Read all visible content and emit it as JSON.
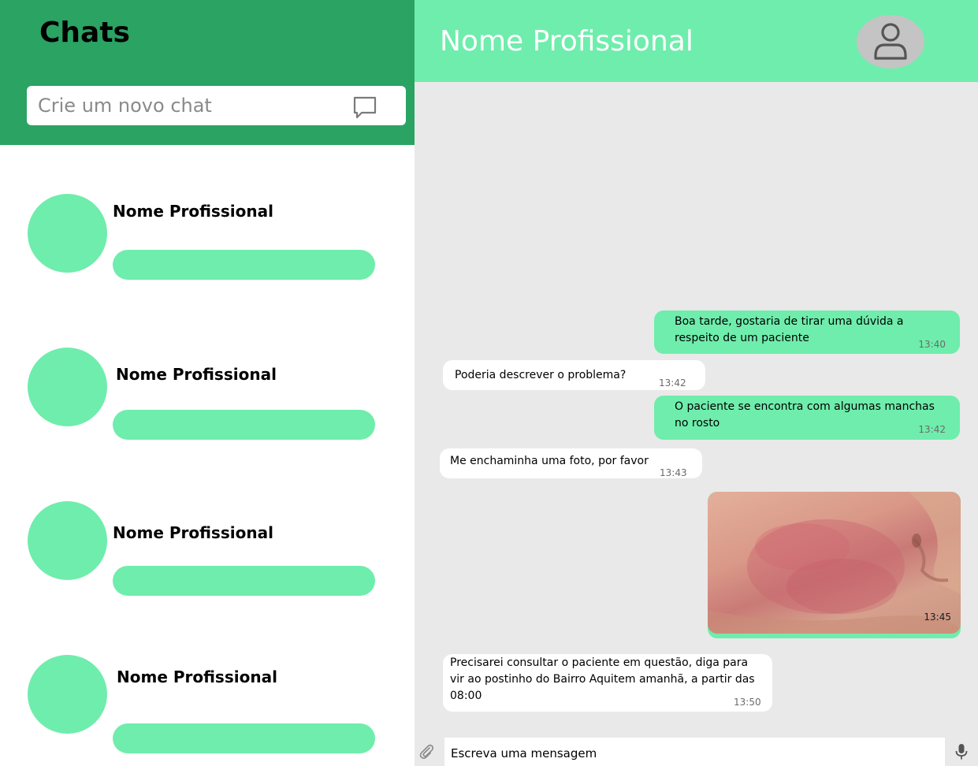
{
  "sidebar": {
    "title": "Chats",
    "search_placeholder": "Crie um novo chat",
    "chats": [
      {
        "name": "Nome Profissional"
      },
      {
        "name": "Nome Profissional"
      },
      {
        "name": "Nome Profissional"
      },
      {
        "name": "Nome Profissional"
      }
    ]
  },
  "conversation": {
    "contact_name": "Nome Profissional",
    "messages": [
      {
        "direction": "outgoing",
        "text": "Boa tarde, gostaria de tirar uma dúvida a respeito de um paciente",
        "time": "13:40"
      },
      {
        "direction": "incoming",
        "text": "Poderia descrever o problema?",
        "time": "13:42"
      },
      {
        "direction": "outgoing",
        "text": "O paciente se encontra com algumas manchas no rosto",
        "time": "13:42"
      },
      {
        "direction": "incoming",
        "text": "Me enchaminha uma foto, por favor",
        "time": "13:43"
      },
      {
        "direction": "outgoing",
        "type": "image",
        "time": "13:45"
      },
      {
        "direction": "incoming",
        "text": "Precisarei consultar o paciente em questão, diga para vir ao postinho do Bairro Aquitem amanhã, a partir das 08:00",
        "time": "13:50"
      }
    ],
    "composer_placeholder": "Escreva uma mensagem"
  },
  "icons": {
    "new_chat": "chat-bubble-icon",
    "profile": "user-icon",
    "attach": "paperclip-icon",
    "mic": "microphone-icon"
  },
  "colors": {
    "sidebar_header": "#2aa363",
    "accent": "#6fedac",
    "chat_background": "#e9e9e9",
    "incoming_bubble": "#ffffff",
    "avatar_placeholder": "#c4c4c4"
  }
}
